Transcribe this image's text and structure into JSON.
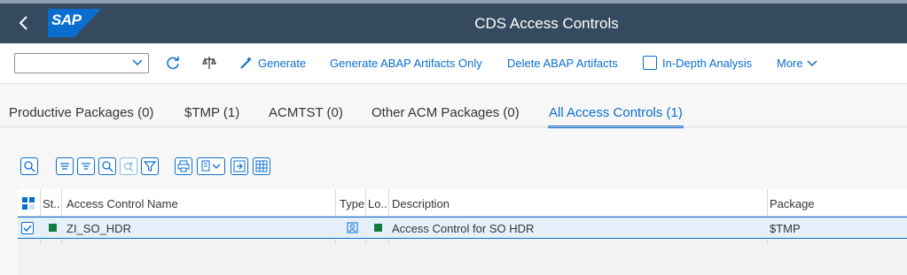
{
  "shell": {
    "logo_text": "SAP",
    "title": "CDS Access Controls"
  },
  "toolbar": {
    "select_value": "",
    "generate_label": "Generate",
    "generate_abap_label": "Generate ABAP Artifacts Only",
    "delete_abap_label": "Delete ABAP Artifacts",
    "in_depth_label": "In-Depth Analysis",
    "more_label": "More"
  },
  "tabs": [
    {
      "label": "Productive Packages (0)"
    },
    {
      "label": "$TMP (1)"
    },
    {
      "label": "ACMTST (0)"
    },
    {
      "label": "Other ACM Packages (0)"
    },
    {
      "label": "All Access Controls (1)"
    }
  ],
  "grid": {
    "columns": [
      "St..",
      "Access Control Name",
      "Type",
      "Lo..",
      "Description",
      "Package"
    ],
    "rows": [
      {
        "name": "ZI_SO_HDR",
        "description": "Access Control for SO HDR",
        "package": "$TMP"
      }
    ]
  },
  "colors": {
    "shell": "#354a5f",
    "accent": "#0a6ed1",
    "status_green": "#107e3e"
  }
}
